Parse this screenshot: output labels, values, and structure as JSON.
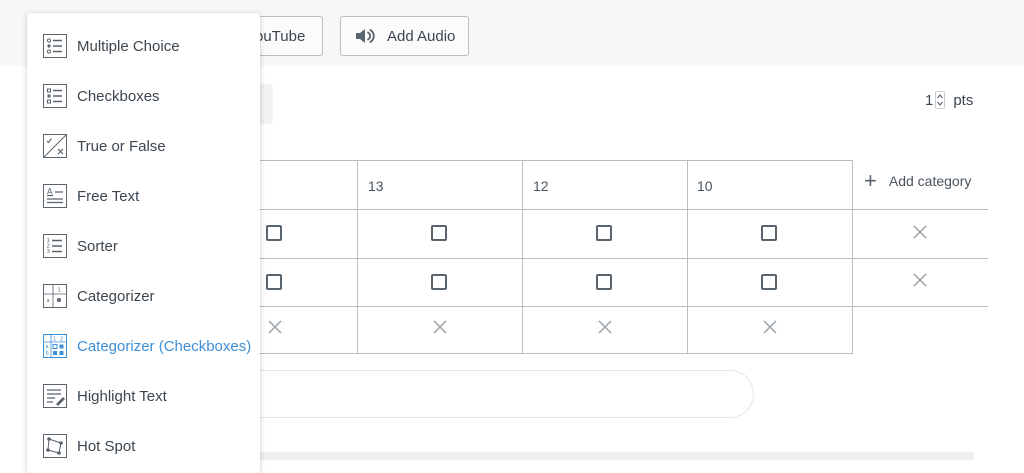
{
  "toolbar": {
    "youtube_label": "ouTube",
    "audio_label": "Add Audio"
  },
  "points": {
    "value": "1",
    "unit": "pts"
  },
  "table": {
    "headers": [
      "13",
      "12",
      "10"
    ],
    "add_category_label": "Add category"
  },
  "menu": {
    "items": [
      {
        "label": "Multiple Choice",
        "icon": "multiple-choice-icon"
      },
      {
        "label": "Checkboxes",
        "icon": "checkboxes-icon"
      },
      {
        "label": "True or False",
        "icon": "true-false-icon"
      },
      {
        "label": "Free Text",
        "icon": "free-text-icon"
      },
      {
        "label": "Sorter",
        "icon": "sorter-icon"
      },
      {
        "label": "Categorizer",
        "icon": "categorizer-icon"
      },
      {
        "label": "Categorizer (Checkboxes)",
        "icon": "categorizer-checkboxes-icon",
        "active": true
      },
      {
        "label": "Highlight Text",
        "icon": "highlight-text-icon"
      },
      {
        "label": "Hot Spot",
        "icon": "hot-spot-icon"
      }
    ]
  },
  "colors": {
    "accent": "#3d8fd6",
    "border": "#b9bec3",
    "text": "#3c4650"
  }
}
